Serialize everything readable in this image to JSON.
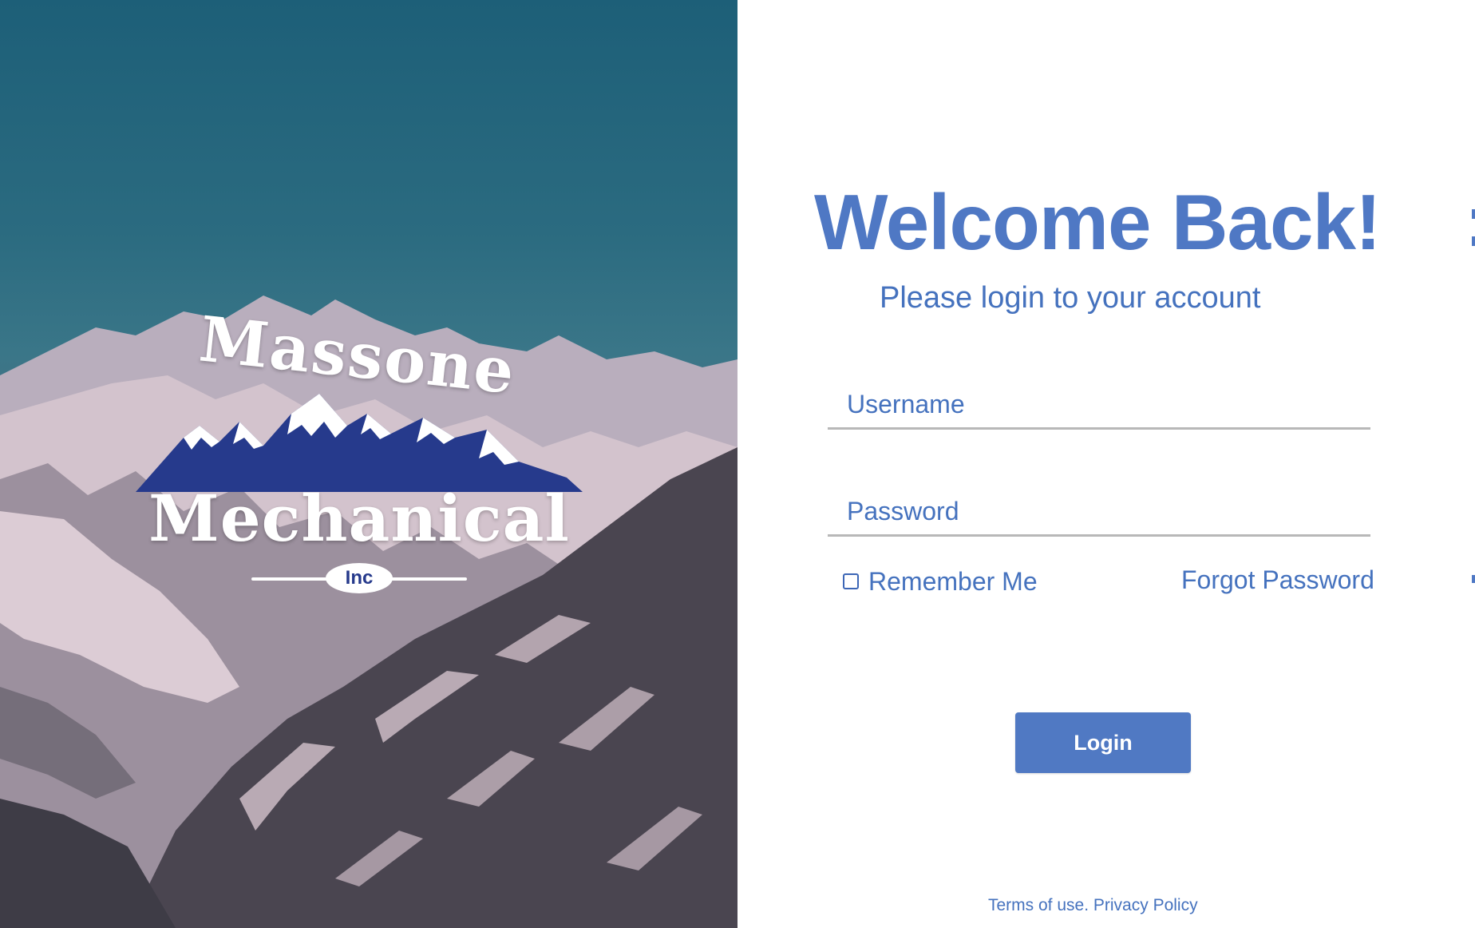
{
  "hero": {
    "logo": {
      "line1": "Massone",
      "line2": "Mechanical",
      "suffix": "Inc"
    },
    "colors": {
      "sky": "#1d5f78",
      "snow": "#c9b7c3",
      "rock": "#3b3d47",
      "logo_peaks": "#263a8c"
    }
  },
  "login": {
    "title": "Welcome Back!",
    "subtitle": "Please login to your account",
    "username": {
      "placeholder": "Username",
      "value": ""
    },
    "password": {
      "placeholder": "Password",
      "value": ""
    },
    "remember_me": {
      "label": "Remember Me",
      "checked": false
    },
    "forgot_password": "Forgot Password",
    "submit_label": "Login",
    "footer": {
      "terms": "Terms of use.",
      "privacy": "Privacy Policy"
    },
    "colors": {
      "accent": "#4f78c4",
      "button": "#5079c3",
      "underline": "#b8b8b8"
    }
  }
}
